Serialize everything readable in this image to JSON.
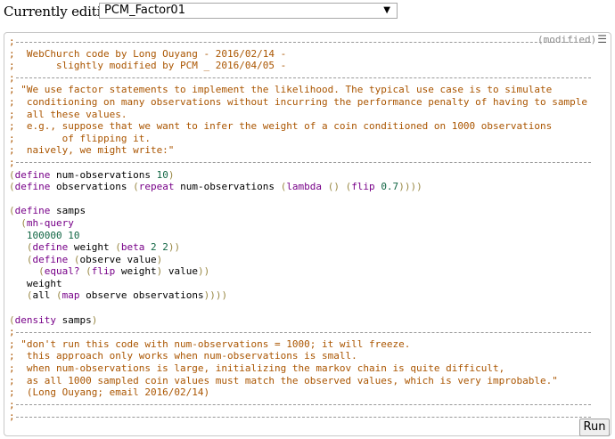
{
  "header": {
    "label": "Currently editing:",
    "selected_program": "PCM_Factor01",
    "dropdown_arrow": "▼"
  },
  "editor": {
    "status": "(modified)",
    "menu_glyph": "☰",
    "lines": [
      ";",
      ";  WebChurch code by Long Ouyang - 2016/02/14 -",
      ";       slightly modified by PCM _ 2016/04/05 -",
      ";",
      "; \"We use factor statements to implement the likelihood. The typical use case is to simulate",
      ";  conditioning on many observations without incurring the performance penalty of having to sample",
      ";  all these values.",
      ";  e.g., suppose that we want to infer the weight of a coin conditioned on 1000 observations",
      ";        of flipping it.",
      ";  naively, we might write:\"",
      ";",
      "(define num-observations 10)",
      "(define observations (repeat num-observations (lambda () (flip 0.7))))",
      "",
      "(define samps",
      "  (mh-query",
      "   100000 10",
      "   (define weight (beta 2 2))",
      "   (define (observe value)",
      "     (equal? (flip weight) value))",
      "   weight",
      "   (all (map observe observations))))",
      "",
      "(density samps)",
      ";",
      "; \"don't run this code with num-observations = 1000; it will freeze.",
      ";  this approach only works when num-observations is small.",
      ";  when num-observations is large, initializing the markov chain is quite difficult,",
      ";  as all 1000 sampled coin values must match the observed values, which is very improbable.\"",
      ";  (Long Ouyang; email 2016/02/14)",
      ";",
      ";"
    ]
  },
  "buttons": {
    "run": "Run"
  }
}
